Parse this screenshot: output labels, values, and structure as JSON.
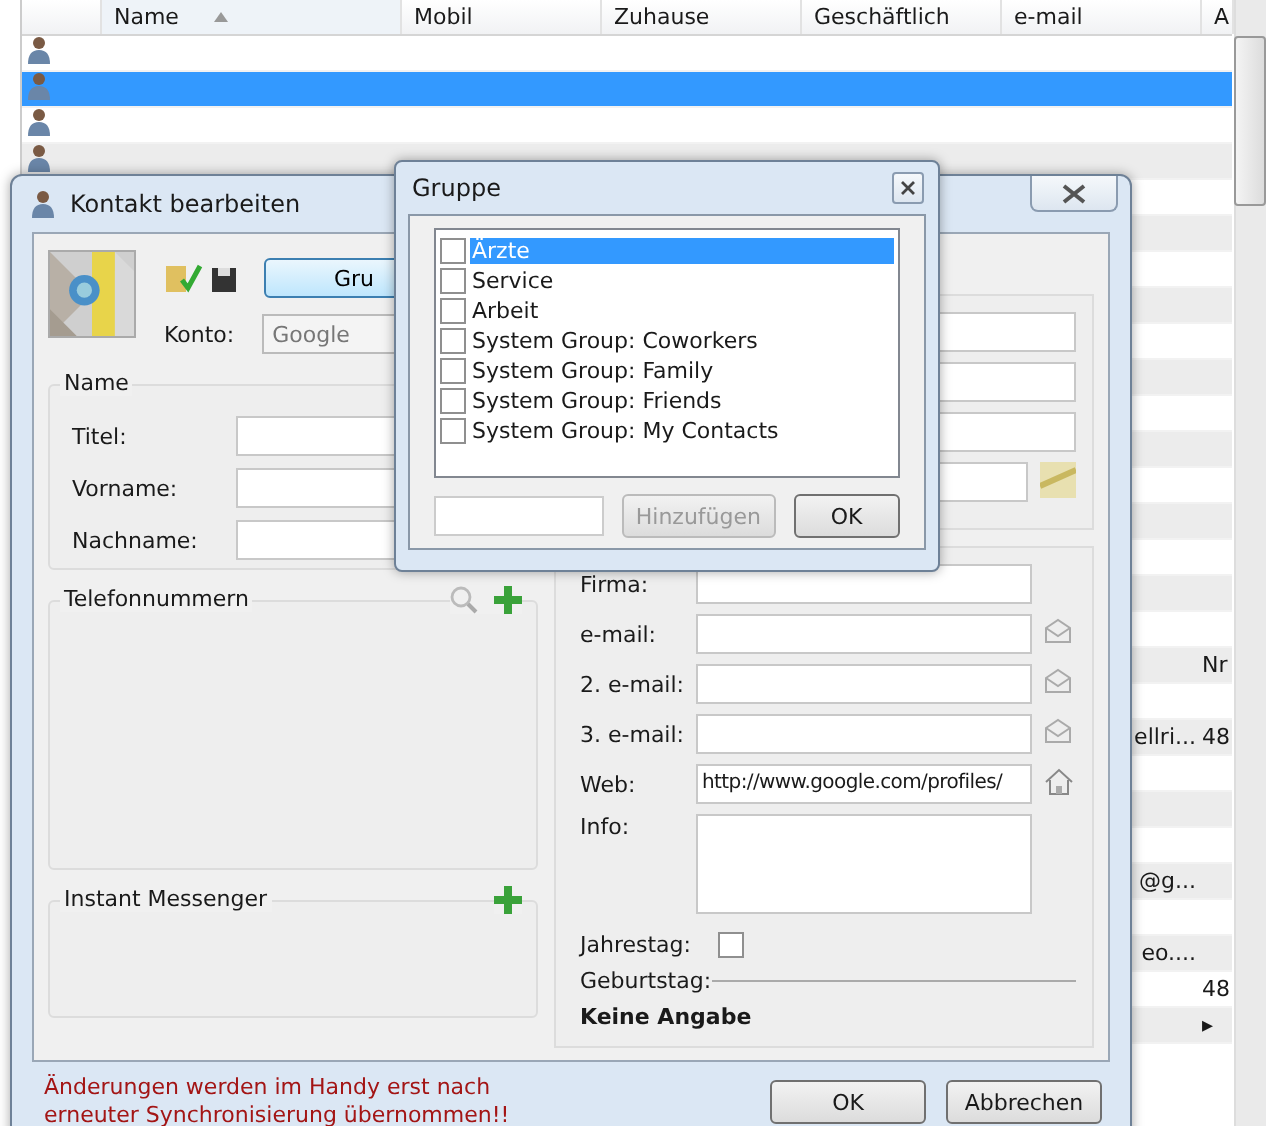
{
  "contact_list": {
    "columns": [
      {
        "label": "Name",
        "sorted": true
      },
      {
        "label": "Mobil",
        "sorted": false
      },
      {
        "label": "Zuhause",
        "sorted": false
      },
      {
        "label": "Geschäftlich",
        "sorted": false
      },
      {
        "label": "e-mail",
        "sorted": false
      },
      {
        "label": "A",
        "sorted": false
      }
    ],
    "rows": [
      {
        "selected": false,
        "person_icon": true
      },
      {
        "selected": true,
        "person_icon": true
      },
      {
        "selected": false,
        "person_icon": true
      },
      {
        "selected": false,
        "person_icon": true
      },
      {
        "selected": false
      },
      {
        "selected": false
      },
      {
        "selected": false
      },
      {
        "selected": false
      },
      {
        "selected": false
      },
      {
        "selected": false
      },
      {
        "selected": false
      },
      {
        "selected": false
      },
      {
        "selected": false
      },
      {
        "selected": false
      },
      {
        "selected": false
      },
      {
        "selected": false
      },
      {
        "selected": false
      },
      {
        "selected": false,
        "col_a": "Nr"
      },
      {
        "selected": false
      },
      {
        "selected": false,
        "email": "ellri...",
        "col_a": "48"
      },
      {
        "selected": false
      },
      {
        "selected": false
      },
      {
        "selected": false
      },
      {
        "selected": false,
        "email": "@g..."
      },
      {
        "selected": false
      },
      {
        "selected": false,
        "email": "eo...."
      },
      {
        "selected": false,
        "col_a": "48"
      },
      {
        "selected": false,
        "col_a": "▸"
      }
    ]
  },
  "contact_dialog": {
    "title": "Kontakt bearbeiten",
    "group_button": "Gru",
    "account_label": "Konto:",
    "account": "Google",
    "name_group": {
      "title": "Name",
      "fields": [
        {
          "label": "Titel:"
        },
        {
          "label": "Vorname:"
        },
        {
          "label": "Nachname:"
        }
      ]
    },
    "phone_group": {
      "title": "Telefonnummern"
    },
    "messenger_group": {
      "title": "Instant Messenger"
    },
    "details": [
      {
        "label": "Firma:",
        "kind": "text"
      },
      {
        "label": "e-mail:",
        "kind": "mail"
      },
      {
        "label": "2. e-mail:",
        "kind": "mail"
      },
      {
        "label": "3. e-mail:",
        "kind": "mail"
      },
      {
        "label": "Web:",
        "kind": "web",
        "value": "http://www.google.com/profiles/"
      },
      {
        "label": "Info:",
        "kind": "area"
      }
    ],
    "anniversary": {
      "label": "Jahrestag:",
      "checked": false
    },
    "birthday": {
      "label": "Geburtstag:",
      "value": "Keine Angabe"
    },
    "notice": "Änderungen werden im Handy erst nach erneuter Synchronisierung übernommen!!",
    "buttons": [
      "OK",
      "Abbrechen"
    ]
  },
  "group_dialog": {
    "title": "Gruppe",
    "items": [
      {
        "label": "Ärzte",
        "checked": false,
        "selected": true
      },
      {
        "label": "Service",
        "checked": false,
        "selected": false
      },
      {
        "label": "Arbeit",
        "checked": false,
        "selected": false
      },
      {
        "label": "System Group: Coworkers",
        "checked": false,
        "selected": false
      },
      {
        "label": "System Group: Family",
        "checked": false,
        "selected": false
      },
      {
        "label": "System Group: Friends",
        "checked": false,
        "selected": false
      },
      {
        "label": "System Group: My Contacts",
        "checked": false,
        "selected": false
      }
    ],
    "add_button": {
      "label": "Hinzufügen",
      "disabled": true
    },
    "ok_button": "OK"
  }
}
